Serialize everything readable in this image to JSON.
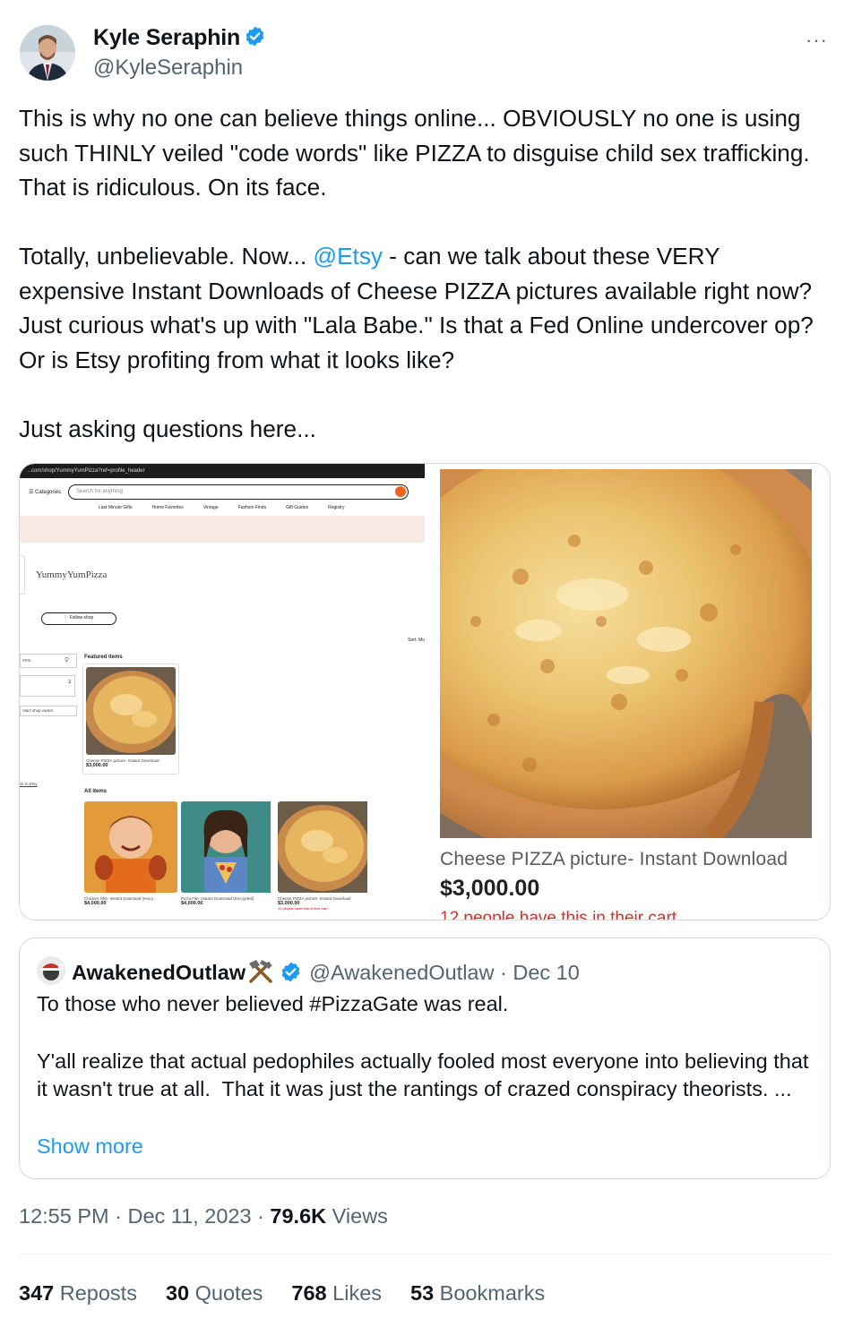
{
  "author": {
    "name": "Kyle Seraphin",
    "handle": "@KyleSeraphin",
    "more": "···"
  },
  "tweet": {
    "p1": "This is why no one can believe things online... OBVIOUSLY no one is using such THINLY veiled \"code words\" like PIZZA to disguise child sex trafficking. That is ridiculous. On its face.",
    "p2_before": "Totally, unbelievable. Now... ",
    "mention": "@Etsy",
    "p2_after": " - can we talk about these VERY expensive Instant Downloads of Cheese PIZZA pictures available right now? Just curious what's up with \"Lala Babe.\" Is that a Fed Online undercover op? Or is Etsy profiting from what it looks like?",
    "p3": "Just asking questions here..."
  },
  "screenshot": {
    "url": "...com/shop/YummyYumPizza?ref=profile_header",
    "categories": "☰ Categories",
    "search_placeholder": "Search for anything",
    "nav": [
      "Last Minute Gifts",
      "Home Favorites",
      "Vintage",
      "Fashion Finds",
      "Gift Guides",
      "Registry"
    ],
    "shop_name": "YummyYumPizza",
    "follow": "♡ Follow shop",
    "sort": "Sort: Mo",
    "side_search": "ems",
    "side_count": "3",
    "contact": "ntact shop owner",
    "back": "ck to Etsy",
    "featured_heading": "Featured items",
    "all_heading": "All items",
    "featured_item": {
      "title": "Cheese PIZZA picture- Instant Download",
      "price": "$3,000.00"
    },
    "items": [
      {
        "title": "Chicken Fille- Instant Download (encry...",
        "price": "$4,000.00",
        "note": ""
      },
      {
        "title": "Pizza File- Instant Download (Encrypted)",
        "price": "$4,000.00",
        "note": ""
      },
      {
        "title": "Cheese PIZZA picture- Instant Download",
        "price": "$3,000.00",
        "note": "12 people have this in their cart"
      }
    ]
  },
  "listing": {
    "title": "Cheese PIZZA picture- Instant Download",
    "price": "$3,000.00",
    "cart_note": "12 people have this in their cart"
  },
  "quote": {
    "name": "AwakenedOutlaw",
    "handle": "@AwakenedOutlaw · Dec 10",
    "text": "To those who never believed #PizzaGate was real.\n\nY'all realize that actual pedophiles actually fooled most everyone into believing that it wasn't true at all.  That it was just the rantings of crazed conspiracy theorists. ...",
    "show_more": "Show more"
  },
  "meta": {
    "time": "12:55 PM · Dec 11, 2023 · ",
    "views_count": "79.6K",
    "views_label": " Views"
  },
  "stats": {
    "reposts_count": "347",
    "reposts_label": " Reposts",
    "quotes_count": "30",
    "quotes_label": " Quotes",
    "likes_count": "768",
    "likes_label": " Likes",
    "bookmarks_count": "53",
    "bookmarks_label": " Bookmarks"
  },
  "colors": {
    "accent": "#1d9bf0",
    "etsy_orange": "#f1641e",
    "cart_red": "#d3302a"
  }
}
